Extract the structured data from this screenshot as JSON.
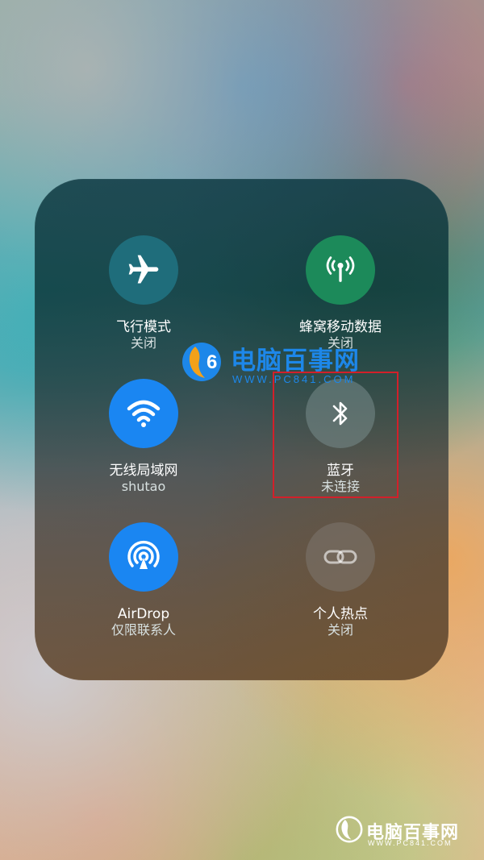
{
  "control_center": {
    "tiles": [
      {
        "label": "飞行模式",
        "status": "关闭",
        "icon": "airplane-icon",
        "state": "off"
      },
      {
        "label": "蜂窝移动数据",
        "status": "关闭",
        "icon": "cellular-antenna-icon",
        "state": "on"
      },
      {
        "label": "无线局域网",
        "status": "shutao",
        "icon": "wifi-icon",
        "state": "on"
      },
      {
        "label": "蓝牙",
        "status": "未连接",
        "icon": "bluetooth-icon",
        "state": "on"
      },
      {
        "label": "AirDrop",
        "status": "仅限联系人",
        "icon": "airdrop-icon",
        "state": "on"
      },
      {
        "label": "个人热点",
        "status": "关闭",
        "icon": "hotspot-link-icon",
        "state": "off"
      }
    ]
  },
  "watermarks": {
    "brand": "电脑百事网",
    "url": "WWW.PC841.COM"
  },
  "colors": {
    "wifi_blue": "#1a86f2",
    "cellular_green": "#1c8a5a",
    "airplane_teal": "#1f6d7b",
    "highlight_red": "#d2202a",
    "watermark_blue": "#1d87e9"
  }
}
